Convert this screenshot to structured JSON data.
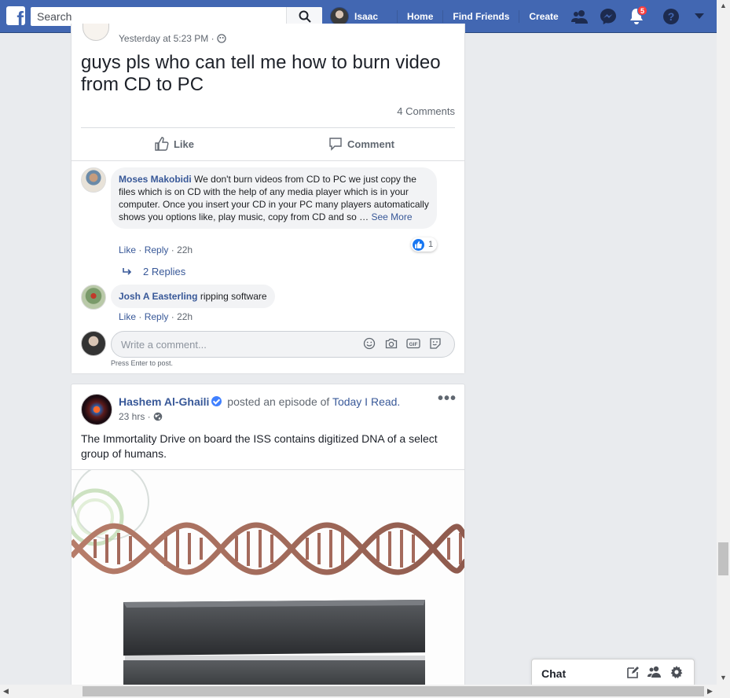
{
  "topbar": {
    "logo": "f",
    "search_placeholder": "Search",
    "profile_name": "Isaac",
    "home": "Home",
    "find_friends": "Find Friends",
    "create": "Create",
    "notification_count": "5",
    "accent_color": "#4267b2",
    "icons": [
      "friend-requests-icon",
      "messenger-icon",
      "notifications-icon",
      "help-icon",
      "account-menu-icon"
    ]
  },
  "post1": {
    "time": "Yesterday at 5:23 PM ·",
    "text": "guys pls who can tell me how to burn video from CD to PC",
    "comments_count": "4 Comments",
    "like_label": "Like",
    "comment_label": "Comment",
    "comments": [
      {
        "name": "Moses Makobidi",
        "text": "We don't burn videos from CD to PC we just copy the files which is on CD with the help of any media player which is in your computer. Once you insert your CD in your PC many players automatically shows you options like, play music, copy from CD and so …",
        "see_more": "See More",
        "like": "Like",
        "reply": "Reply",
        "time": "22h",
        "reaction_count": "1",
        "replies": "2 Replies"
      },
      {
        "name": "Josh A Easterling",
        "text": "ripping software",
        "like": "Like",
        "reply": "Reply",
        "time": "22h"
      }
    ],
    "write_placeholder": "Write a comment...",
    "press_enter": "Press Enter to post."
  },
  "post2": {
    "author": "Hashem Al-Ghaili",
    "action": "posted an episode of",
    "page": "Today I Read.",
    "time": "23 hrs ·",
    "text": "The Immortality Drive on board the ISS contains digitized DNA of a select group of humans."
  },
  "chat": {
    "label": "Chat"
  }
}
